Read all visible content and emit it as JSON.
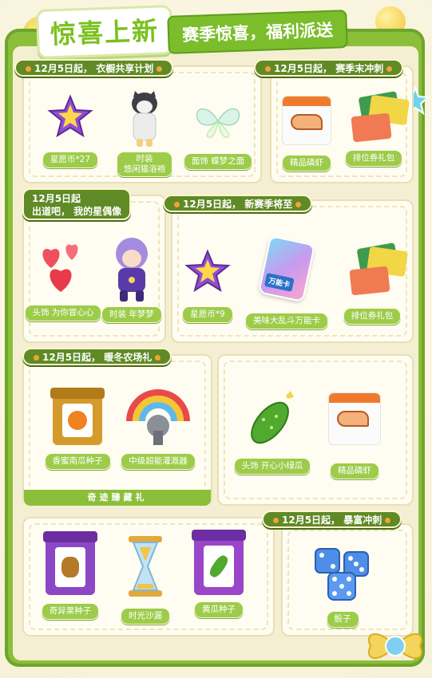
{
  "header": {
    "title_main": "惊喜上新",
    "title_sub": "赛季惊喜，福利派送"
  },
  "panels": [
    {
      "tag": "12月5日起， 衣橱共享计划",
      "items": [
        {
          "label": "星愿币*27",
          "icon": "purple-star-icon"
        },
        {
          "label": "时装\n悠闲猫浴袍",
          "icon": "cat-bathrobe-costume-icon"
        },
        {
          "label": "面饰 蝶梦之面",
          "icon": "butterfly-mask-icon"
        }
      ]
    },
    {
      "tag": "12月5日起， 赛季末冲刺",
      "items": [
        {
          "label": "精品磷虾",
          "icon": "krill-bag-icon"
        },
        {
          "label": "排位券礼包",
          "icon": "ranking-ticket-pack-icon"
        }
      ]
    },
    {
      "tag_line1": "12月5日起",
      "tag_line2": "出道吧， 我的星偶像",
      "items": [
        {
          "label": "头饰 为你冒心心",
          "icon": "hearts-headwear-icon"
        },
        {
          "label": "时装 年梦梦",
          "icon": "idol-costume-icon"
        }
      ]
    },
    {
      "tag": "12月5日起， 新赛季将至",
      "items": [
        {
          "label": "星愿币*9",
          "icon": "purple-star-icon"
        },
        {
          "label": "美味大乱斗万能卡",
          "icon": "universal-card-icon",
          "card_text": "万能卡"
        },
        {
          "label": "排位券礼包",
          "icon": "ranking-ticket-pack-icon"
        }
      ]
    },
    {
      "tag": "12月5日起， 暖冬农场礼",
      "items": [
        {
          "label": "香蜜南瓜种子",
          "icon": "pumpkin-seed-bag-icon"
        },
        {
          "label": "中级超能灌溉器",
          "icon": "rainbow-sprinkler-icon"
        }
      ],
      "footer": "奇迹臻藏礼"
    },
    {
      "items": [
        {
          "label": "头饰 开心小绿瓜",
          "icon": "cucumber-headwear-icon"
        },
        {
          "label": "精品磷虾",
          "icon": "krill-bag-icon"
        }
      ]
    },
    {
      "items": [
        {
          "label": "奇异果种子",
          "icon": "kiwi-seed-bag-icon"
        },
        {
          "label": "时光沙漏",
          "icon": "hourglass-icon"
        },
        {
          "label": "黄瓜种子",
          "icon": "cucumber-seed-bag-icon"
        }
      ]
    },
    {
      "tag": "12月5日起， 暴富冲刺",
      "items": [
        {
          "label": "骰子",
          "icon": "dice-icon"
        }
      ]
    }
  ],
  "colors": {
    "accent_green": "#7bbd2a",
    "tag_green": "#5f8a25",
    "label_green": "#9ccc4a",
    "panel_bg": "#fffdf1"
  }
}
